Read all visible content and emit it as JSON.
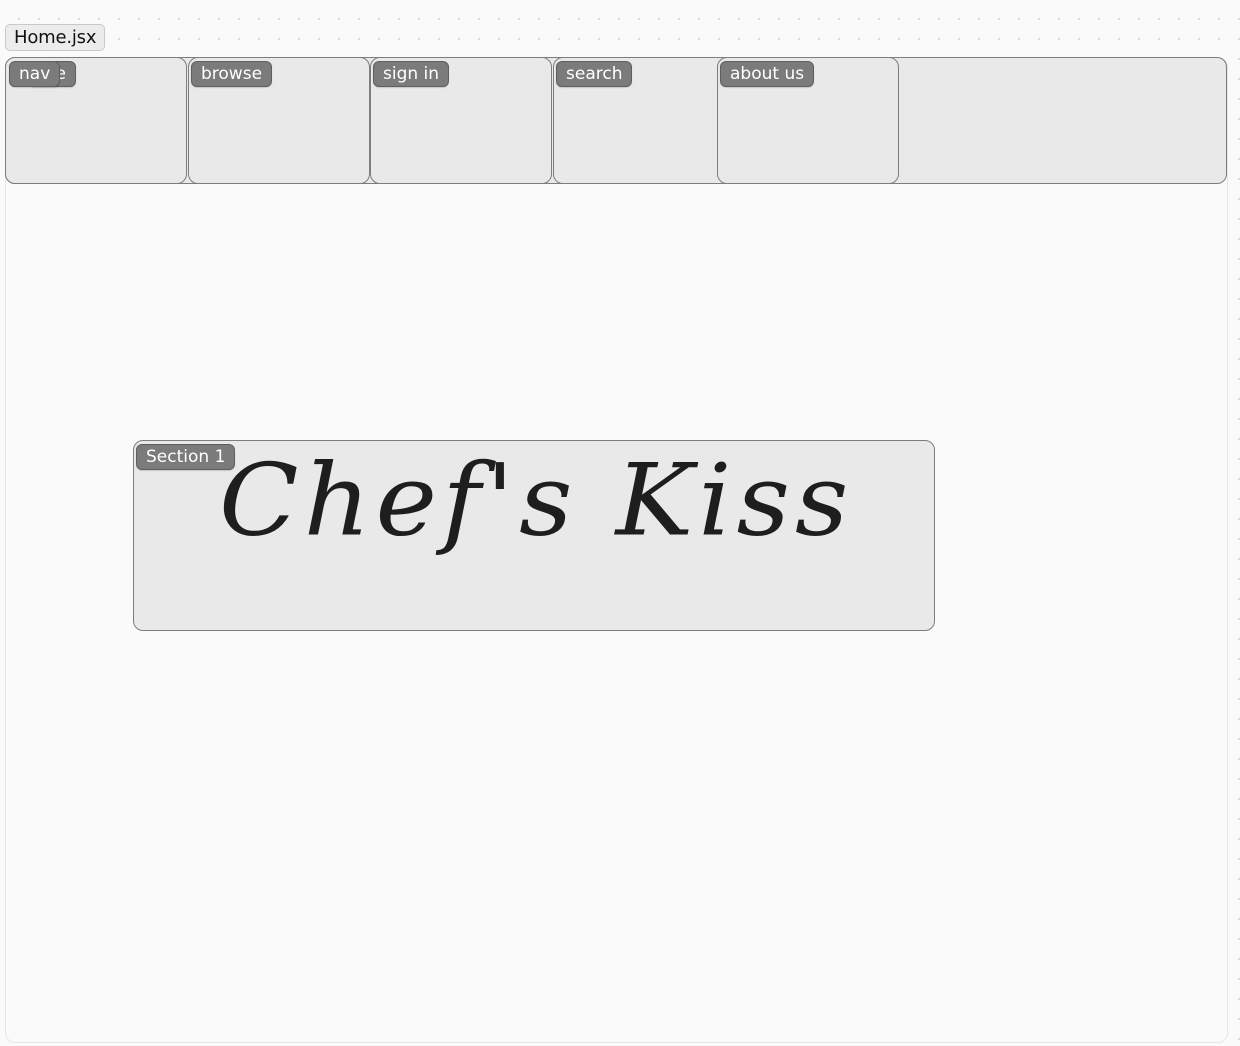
{
  "file_tab": {
    "label": "Home.jsx"
  },
  "nav": {
    "label": "nav",
    "hidden_label_fragment": "e",
    "items": [
      {
        "label": "browse"
      },
      {
        "label": "sign in"
      },
      {
        "label": "search"
      },
      {
        "label": "about us"
      }
    ]
  },
  "section1": {
    "label": "Section 1",
    "heading": "Chef's Kiss"
  },
  "colors": {
    "canvas_bg": "#fafafa",
    "box_bg": "#e9e9e9",
    "box_border": "#7d7d7d",
    "chip_bg": "#7b7b7b",
    "chip_text": "#ffffff",
    "heading_text": "#1e1e1e"
  }
}
